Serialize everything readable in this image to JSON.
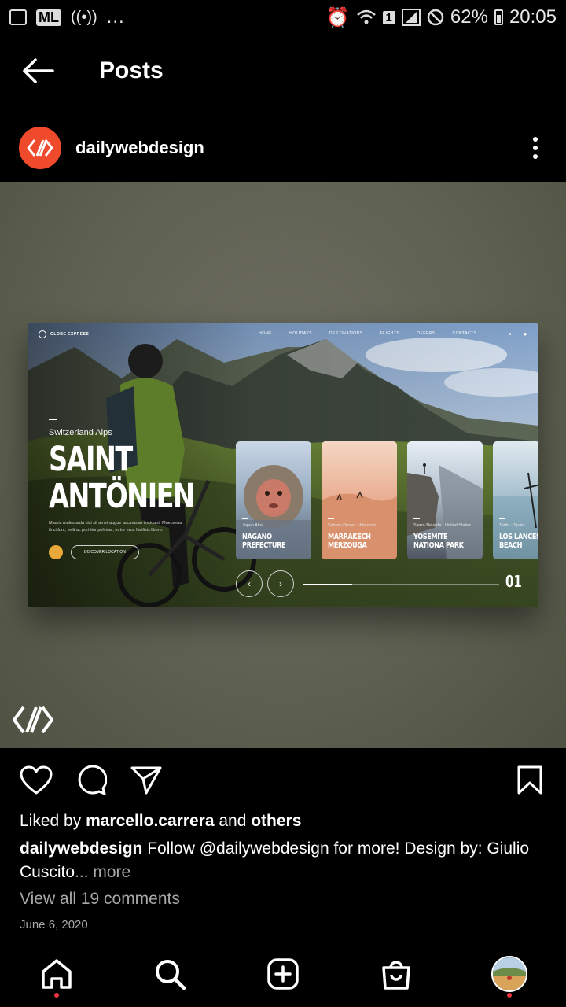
{
  "status_bar": {
    "left_icons": [
      "gallery-icon",
      "ml-icon",
      "hotspot-icon"
    ],
    "ml_label": "ML",
    "more": "...",
    "right_icons": [
      "alarm-icon",
      "wifi-icon",
      "sim-icon",
      "signal-icon",
      "dnd-icon",
      "battery-icon"
    ],
    "sim_number": "1",
    "battery": "62%",
    "time": "20:05"
  },
  "header": {
    "title": "Posts",
    "back_icon": "arrow-left-icon"
  },
  "post": {
    "author": "dailywebdesign",
    "image": {
      "mock": {
        "brand": "GLOBE EXPRESS",
        "nav_links": [
          "HOME",
          "HOLIDAYS",
          "DESTINATIONS",
          "FLIGHTS",
          "OFFERS",
          "CONTACTS"
        ],
        "subtitle": "Switzerland Alps",
        "title_line1": "SAINT",
        "title_line2": "ANTÖNIEN",
        "description": "Mauris malesuada nisi sit amet augue accumsan tincidunt. Maecenas tincidunt, velit ac porttitor pulvinar, tortor eros facilisis libero.",
        "cta": "DISCOVER LOCATION",
        "cards": [
          {
            "location": "Japan Alps",
            "name_line1": "NAGANO",
            "name_line2": "PREFECTURE"
          },
          {
            "location": "Sahara Desert - Morocco",
            "name_line1": "MARRAKECH",
            "name_line2": "MERZOUGA"
          },
          {
            "location": "Sierra Nevada - United States",
            "name_line1": "YOSEMITE",
            "name_line2": "NATIONA PARK"
          },
          {
            "location": "Tarifa - Spain",
            "name_line1": "LOS LANCES",
            "name_line2": "BEACH"
          }
        ],
        "prev": "‹",
        "next": "›",
        "progress": 0.25,
        "page": "01"
      }
    },
    "likes": {
      "prefix": "Liked by ",
      "user": "marcello.carrera",
      "middle": " and ",
      "others": "others"
    },
    "caption": {
      "handle": "dailywebdesign",
      "text": " Follow @dailywebdesign for more!  Design by: Giulio Cuscito",
      "more": "... more"
    },
    "comments": "View all 19 comments",
    "date": "June 6, 2020"
  },
  "bottom_nav": [
    "home-icon",
    "search-icon",
    "create-icon",
    "shop-icon",
    "profile-avatar"
  ],
  "colors": {
    "brand": "#f04a2c",
    "notification_dot": "#f0333e",
    "secondary_text": "#a8a8a8"
  }
}
